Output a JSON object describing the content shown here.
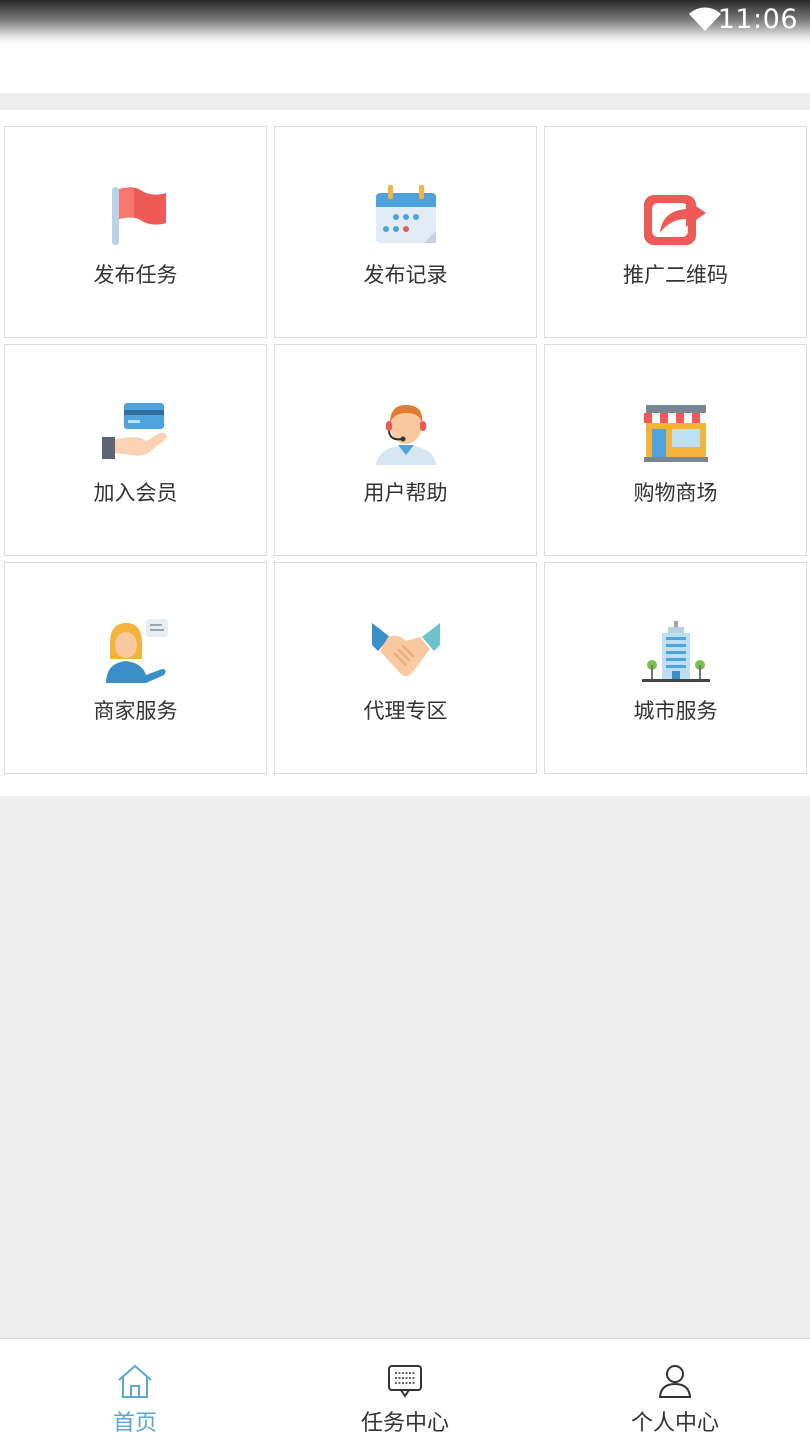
{
  "status_bar": {
    "time": "11:06",
    "wifi_icon": "wifi-icon"
  },
  "menu": {
    "items": [
      {
        "label": "发布任务",
        "icon": "red-flag-icon"
      },
      {
        "label": "发布记录",
        "icon": "calendar-icon"
      },
      {
        "label": "推广二维码",
        "icon": "share-icon"
      },
      {
        "label": "加入会员",
        "icon": "card-in-hand-icon"
      },
      {
        "label": "用户帮助",
        "icon": "customer-service-agent-icon"
      },
      {
        "label": "购物商场",
        "icon": "storefront-icon"
      },
      {
        "label": "商家服务",
        "icon": "merchant-woman-icon"
      },
      {
        "label": "代理专区",
        "icon": "handshake-icon"
      },
      {
        "label": "城市服务",
        "icon": "city-building-icon"
      }
    ]
  },
  "tabbar": {
    "tabs": [
      {
        "label": "首页",
        "icon": "home-icon",
        "active": true
      },
      {
        "label": "任务中心",
        "icon": "message-board-icon",
        "active": false
      },
      {
        "label": "个人中心",
        "icon": "user-icon",
        "active": false
      }
    ]
  },
  "colors": {
    "accent": "#5aa6d6",
    "background": "#ededed",
    "text": "#333333"
  }
}
